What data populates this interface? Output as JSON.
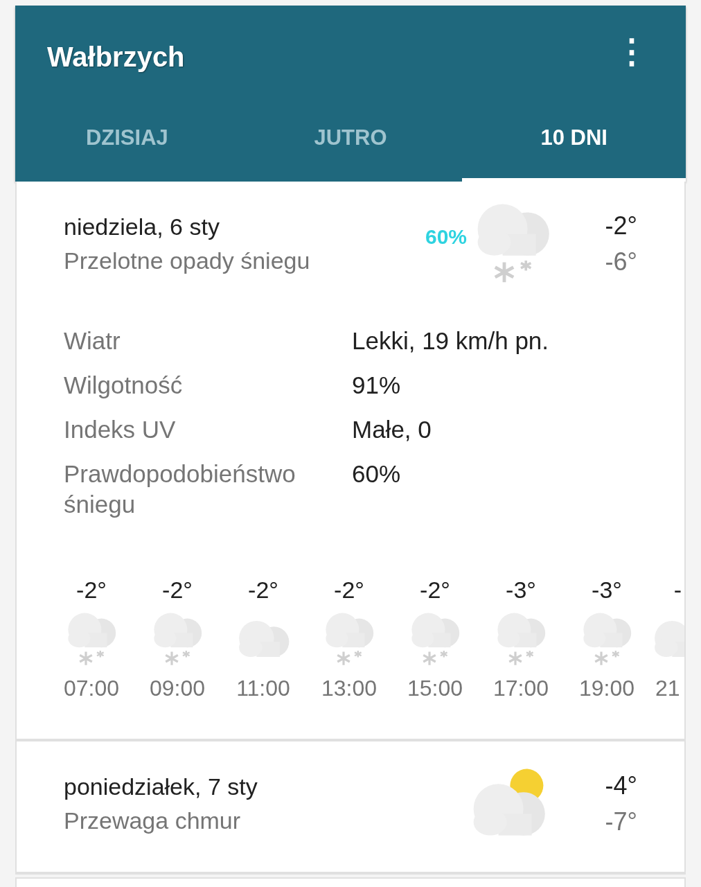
{
  "header": {
    "title": "Wałbrzych",
    "menu_icon": "⋮"
  },
  "tabs": [
    {
      "label": "DZISIAJ",
      "selected": false
    },
    {
      "label": "JUTRO",
      "selected": false
    },
    {
      "label": "10 DNI",
      "selected": true
    }
  ],
  "days": [
    {
      "date": "niedziela, 6 sty",
      "summary": "Przelotne opady śniegu",
      "precip": "60%",
      "kind": "snow",
      "high": "-2°",
      "low": "-6°",
      "expanded": true,
      "details": [
        {
          "label": "Wiatr",
          "value": "Lekki, 19 km/h pn."
        },
        {
          "label": "Wilgotność",
          "value": "91%"
        },
        {
          "label": "Indeks UV",
          "value": "Małe, 0"
        },
        {
          "label": "Prawdopodobieństwo śniegu",
          "value": "60%"
        }
      ],
      "hours": [
        {
          "temp": "-2°",
          "kind": "snow",
          "time": "07:00"
        },
        {
          "temp": "-2°",
          "kind": "snow",
          "time": "09:00"
        },
        {
          "temp": "-2°",
          "kind": "cloud",
          "time": "11:00"
        },
        {
          "temp": "-2°",
          "kind": "snow",
          "time": "13:00"
        },
        {
          "temp": "-2°",
          "kind": "snow",
          "time": "15:00"
        },
        {
          "temp": "-3°",
          "kind": "snow",
          "time": "17:00"
        },
        {
          "temp": "-3°",
          "kind": "snow",
          "time": "19:00"
        },
        {
          "temp": "-",
          "kind": "cloud",
          "time": "21"
        }
      ]
    },
    {
      "date": "poniedziałek, 7 sty",
      "summary": "Przewaga chmur",
      "kind": "partly_sunny",
      "high": "-4°",
      "low": "-7°"
    }
  ]
}
